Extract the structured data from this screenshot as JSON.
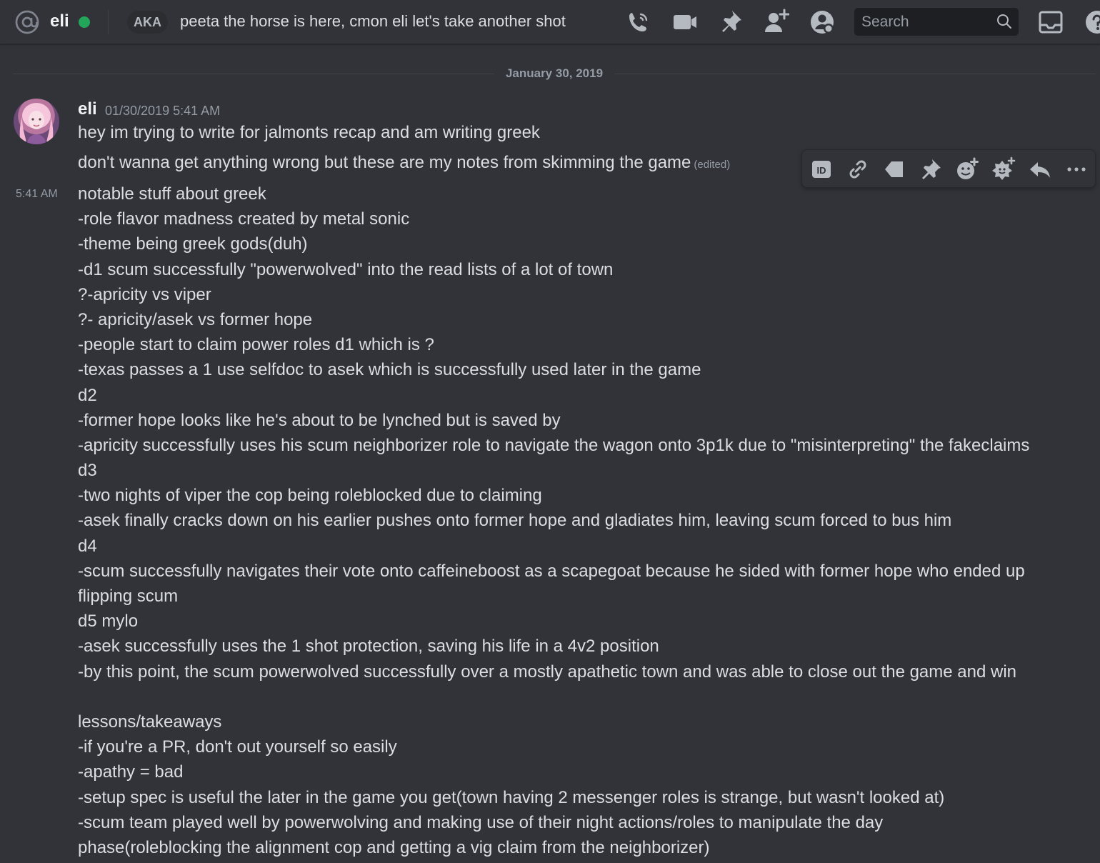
{
  "header": {
    "dm_name": "eli",
    "aka_label": "AKA",
    "nickname": "peeta the horse is here, cmon eli let's take another shot",
    "search_placeholder": "Search",
    "icons": [
      "phone-call-icon",
      "video-camera-icon",
      "pin-icon",
      "add-friend-icon",
      "user-profile-icon",
      "inbox-icon",
      "help-icon"
    ],
    "status_color": "#23a55a"
  },
  "date_divider": "January 30, 2019",
  "message": {
    "author": "eli",
    "timestamp": "01/30/2019 5:41 AM",
    "line1": "hey im trying to write for jalmonts recap and am writing greek",
    "line2": "don't wanna get anything wrong but these are my notes from skimming the game",
    "edited": "(edited)",
    "side_time": "5:41 AM",
    "body": [
      "notable stuff about greek",
      "-role flavor madness created by metal sonic",
      "-theme being greek gods(duh)",
      "-d1 scum successfully \"powerwolved\" into the read lists of a lot of town",
      "?-apricity vs viper",
      "?- apricity/asek vs former hope",
      "-people start to claim power roles d1 which is ?",
      "-texas passes a 1 use selfdoc to asek which is successfully used later in the game",
      "d2",
      "-former hope looks like he's about to be lynched but is saved by",
      "-apricity successfully uses his scum neighborizer role to navigate the wagon onto 3p1k due to \"misinterpreting\" the fakeclaims",
      "d3",
      "-two nights of viper the cop being roleblocked due to claiming",
      "-asek finally cracks down on his earlier pushes onto former hope and gladiates him, leaving scum forced to bus him",
      "d4",
      "-scum successfully navigates their vote onto caffeineboost as a scapegoat because he sided with former hope who ended up flipping scum",
      "d5 mylo",
      "-asek successfully uses the 1 shot protection, saving his life in a 4v2 position",
      "-by this point, the scum powerwolved successfully over a mostly apathetic town and was able to close out the game and win",
      "",
      "lessons/takeaways",
      "-if you're a PR, don't out yourself so easily",
      "-apathy = bad",
      "-setup spec is useful the later in the game you get(town having 2 messenger roles is strange, but wasn't looked at)",
      "-scum team played well by powerwolving and making use of their night actions/roles to manipulate the day phase(roleblocking the alignment cop and getting a vig claim from the neighborizer)"
    ]
  },
  "hover_toolbar": [
    "copy-id-icon",
    "copy-link-icon",
    "mark-unread-icon",
    "pin-message-icon",
    "add-reaction-icon",
    "add-super-reaction-icon",
    "reply-icon",
    "more-options-icon"
  ]
}
